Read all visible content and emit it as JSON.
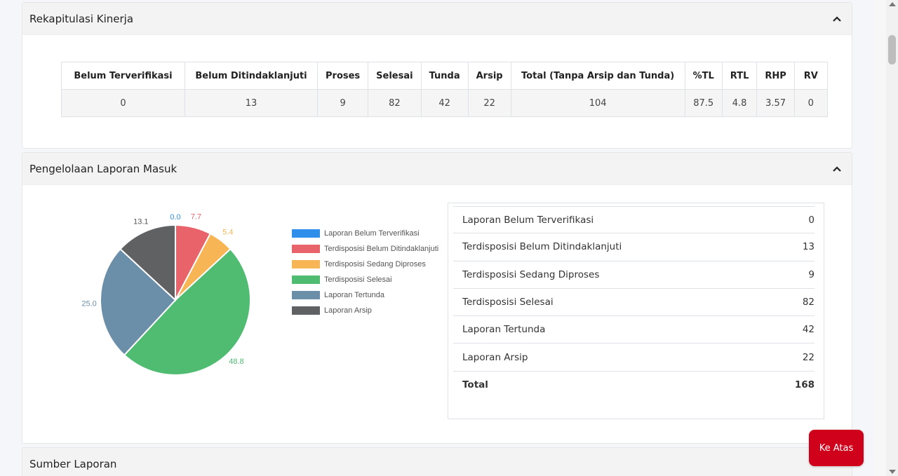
{
  "sections": {
    "rekap": {
      "title": "Rekapitulasi Kinerja",
      "headers": [
        "Belum Terverifikasi",
        "Belum Ditindaklanjuti",
        "Proses",
        "Selesai",
        "Tunda",
        "Arsip",
        "Total (Tanpa Arsip dan Tunda)",
        "%TL",
        "RTL",
        "RHP",
        "RV"
      ],
      "values": [
        "0",
        "13",
        "9",
        "82",
        "42",
        "22",
        "104",
        "87.5",
        "4.8",
        "3.57",
        "0"
      ]
    },
    "pengelolaan": {
      "title": "Pengelolaan Laporan Masuk",
      "rows": [
        {
          "label": "Laporan Belum Terverifikasi",
          "value": "0"
        },
        {
          "label": "Terdisposisi Belum Ditindaklanjuti",
          "value": "13"
        },
        {
          "label": "Terdisposisi Sedang Diproses",
          "value": "9"
        },
        {
          "label": "Terdisposisi Selesai",
          "value": "82"
        },
        {
          "label": "Laporan Tertunda",
          "value": "42"
        },
        {
          "label": "Laporan Arsip",
          "value": "22"
        }
      ],
      "total": {
        "label": "Total",
        "value": "168"
      }
    },
    "sumber": {
      "title": "Sumber Laporan"
    }
  },
  "chart_data": {
    "type": "pie",
    "categories": [
      "Laporan Belum Terverifikasi",
      "Terdisposisi Belum Ditindaklanjuti",
      "Terdisposisi Sedang Diproses",
      "Terdisposisi Selesai",
      "Laporan Tertunda",
      "Laporan Arsip"
    ],
    "values": [
      0.0,
      7.7,
      5.4,
      48.8,
      25.0,
      13.1
    ],
    "labels": [
      "0.0",
      "7.7",
      "5.4",
      "48.8",
      "25.0",
      "13.1"
    ],
    "colors": [
      "#2f8fea",
      "#e9636b",
      "#f7b556",
      "#4fbc72",
      "#6b8fa8",
      "#5f6163"
    ],
    "legend": "right"
  },
  "buttons": {
    "to_top": "Ke Atas"
  },
  "icons": {
    "collapse": "chevron-up-icon"
  }
}
